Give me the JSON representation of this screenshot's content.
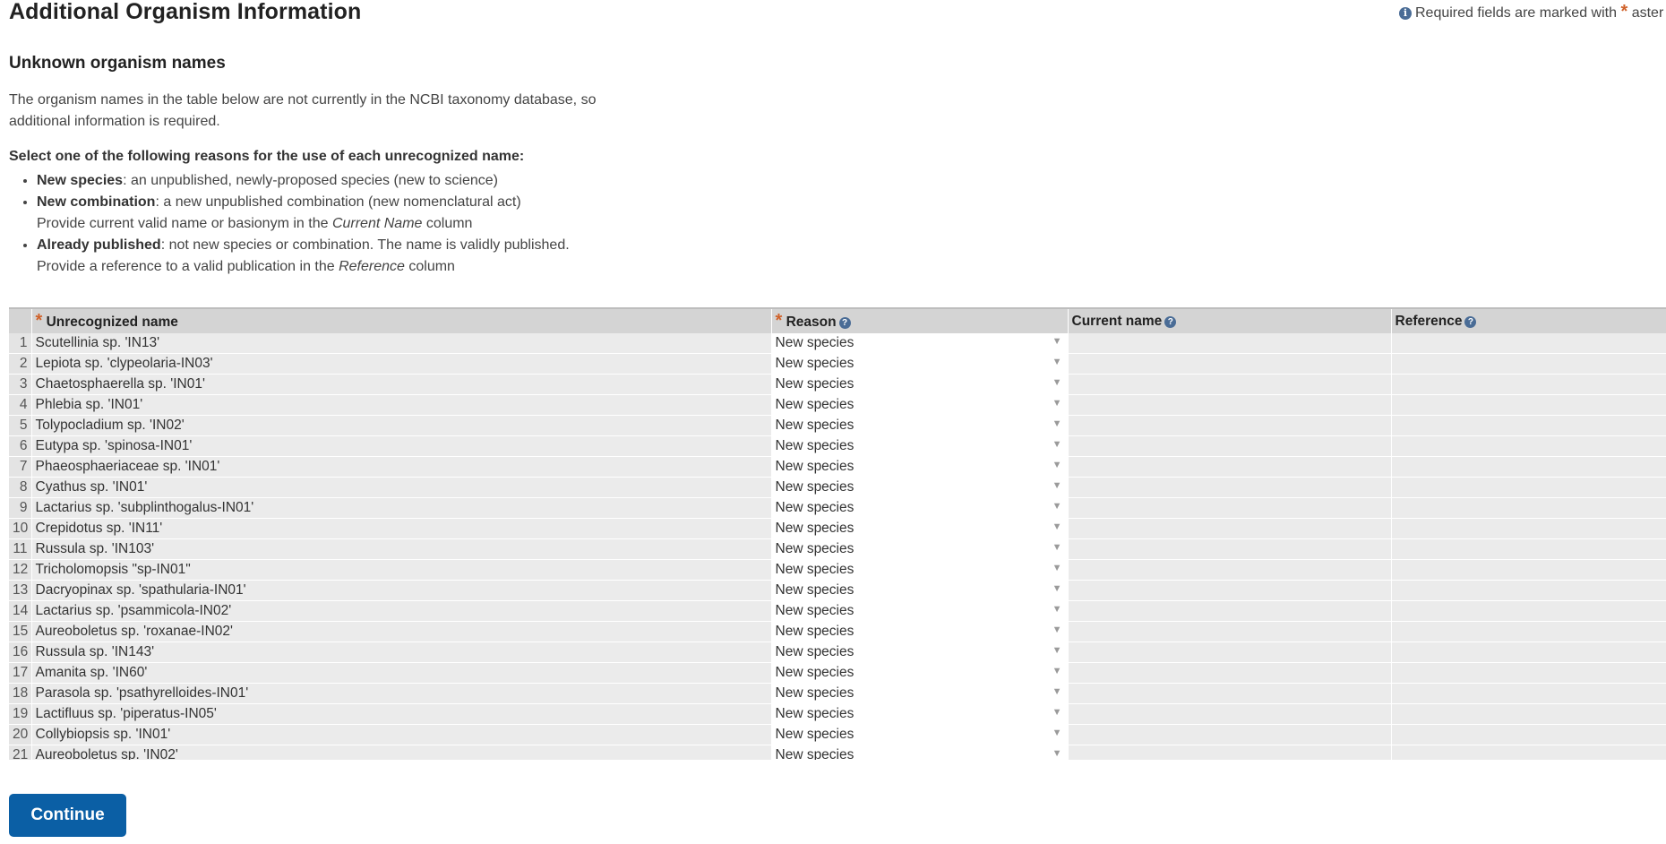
{
  "page": {
    "title": "Additional Organism Information",
    "required_note": "Required fields are marked with",
    "required_note_tail": "aster",
    "section_title": "Unknown organism names",
    "intro": "The organism names in the table below are not currently in the NCBI taxonomy database, so additional information is required.",
    "select_heading": "Select one of the following reasons for the use of each unrecognized name:",
    "reasons": [
      {
        "term": "New species",
        "desc": ": an unpublished, newly-proposed species (new to science)",
        "sub_pre": "",
        "sub_em": "",
        "sub_post": ""
      },
      {
        "term": "New combination",
        "desc": ": a new unpublished combination (new nomenclatural act)",
        "sub_pre": "Provide current valid name or basionym in the ",
        "sub_em": "Current Name",
        "sub_post": " column"
      },
      {
        "term": "Already published",
        "desc": ": not new species or combination. The name is validly published.",
        "sub_pre": "Provide a reference to a valid publication in the ",
        "sub_em": "Reference",
        "sub_post": " column"
      }
    ]
  },
  "table": {
    "headers": {
      "name": "Unrecognized name",
      "reason": "Reason",
      "current": "Current name",
      "reference": "Reference"
    },
    "rows": [
      {
        "num": "1",
        "name": "Scutellinia sp. 'IN13'",
        "reason": "New species"
      },
      {
        "num": "2",
        "name": "Lepiota sp. 'clypeolaria-IN03'",
        "reason": "New species"
      },
      {
        "num": "3",
        "name": "Chaetosphaerella sp. 'IN01'",
        "reason": "New species"
      },
      {
        "num": "4",
        "name": "Phlebia sp. 'IN01'",
        "reason": "New species"
      },
      {
        "num": "5",
        "name": "Tolypocladium sp. 'IN02'",
        "reason": "New species"
      },
      {
        "num": "6",
        "name": "Eutypa sp. 'spinosa-IN01'",
        "reason": "New species"
      },
      {
        "num": "7",
        "name": "Phaeosphaeriaceae sp. 'IN01'",
        "reason": "New species"
      },
      {
        "num": "8",
        "name": "Cyathus sp. 'IN01'",
        "reason": "New species"
      },
      {
        "num": "9",
        "name": "Lactarius sp. 'subplinthogalus-IN01'",
        "reason": "New species"
      },
      {
        "num": "10",
        "name": "Crepidotus sp. 'IN11'",
        "reason": "New species"
      },
      {
        "num": "11",
        "name": "Russula sp. 'IN103'",
        "reason": "New species"
      },
      {
        "num": "12",
        "name": "Tricholomopsis \"sp-IN01\"",
        "reason": "New species"
      },
      {
        "num": "13",
        "name": "Dacryopinax sp. 'spathularia-IN01'",
        "reason": "New species"
      },
      {
        "num": "14",
        "name": "Lactarius sp. 'psammicola-IN02'",
        "reason": "New species"
      },
      {
        "num": "15",
        "name": "Aureoboletus sp. 'roxanae-IN02'",
        "reason": "New species"
      },
      {
        "num": "16",
        "name": "Russula sp. 'IN143'",
        "reason": "New species"
      },
      {
        "num": "17",
        "name": "Amanita sp. 'IN60'",
        "reason": "New species"
      },
      {
        "num": "18",
        "name": "Parasola sp. 'psathyrelloides-IN01'",
        "reason": "New species"
      },
      {
        "num": "19",
        "name": "Lactifluus sp. 'piperatus-IN05'",
        "reason": "New species"
      },
      {
        "num": "20",
        "name": "Collybiopsis sp. 'IN01'",
        "reason": "New species"
      },
      {
        "num": "21",
        "name": "Aureoboletus sp. 'IN02'",
        "reason": "New species"
      }
    ]
  },
  "actions": {
    "continue_label": "Continue"
  },
  "icons": {
    "info": "info-icon",
    "help": "help-icon",
    "required": "asterisk-icon",
    "dropdown": "dropdown-arrow-icon"
  },
  "colors": {
    "accent": "#0b5fa5",
    "required_star": "#d0622a",
    "header_bg": "#d4d4d4",
    "cell_bg": "#ebebeb"
  }
}
